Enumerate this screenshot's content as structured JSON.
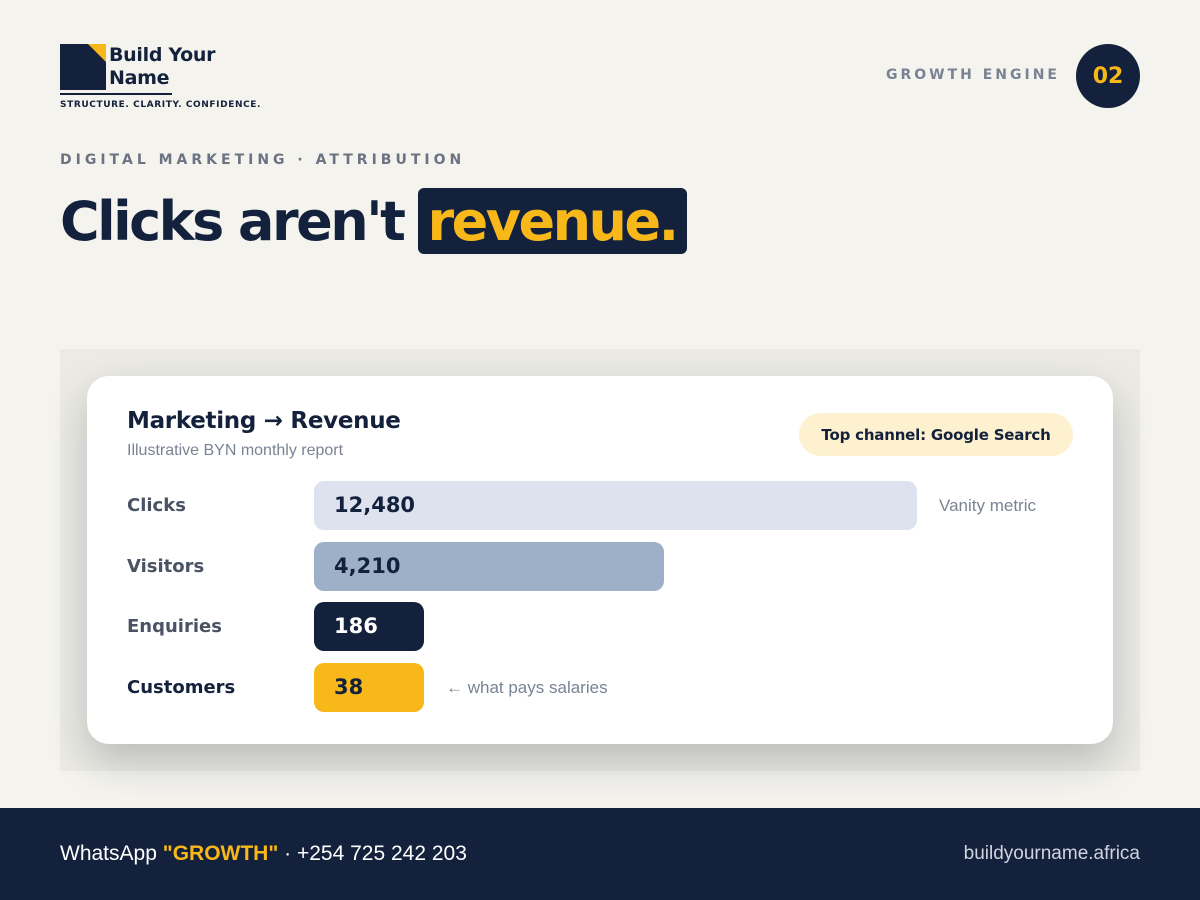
{
  "brand": {
    "name_line1": "Build Your",
    "name_line2": "Name",
    "tagline": "STRUCTURE. CLARITY. CONFIDENCE.",
    "colors": {
      "navy": "#13213c",
      "accent": "#f8b81a",
      "background": "#f4f3ee"
    }
  },
  "header": {
    "section_label": "GROWTH ENGINE",
    "section_number": "02"
  },
  "eyebrow": "DIGITAL MARKETING · ATTRIBUTION",
  "headline": {
    "text": "Clicks aren't",
    "highlight": "revenue."
  },
  "card": {
    "title": "Marketing → Revenue",
    "subtitle": "Illustrative BYN monthly report",
    "pill": "Top channel: Google Search"
  },
  "chart_data": {
    "type": "bar",
    "orientation": "horizontal",
    "title": "Marketing → Revenue",
    "subtitle": "Illustrative BYN monthly report",
    "categories": [
      "Clicks",
      "Visitors",
      "Enquiries",
      "Customers"
    ],
    "values": [
      12480,
      4210,
      186,
      38
    ],
    "value_labels": [
      "12,480",
      "4,210",
      "186",
      "38"
    ],
    "bar_colors": [
      "#dde2ee",
      "#9eb0c8",
      "#13213c",
      "#f8b81a"
    ],
    "annotations": [
      {
        "category": "Clicks",
        "text": "Vanity metric"
      },
      {
        "category": "Customers",
        "text": "← what pays salaries"
      }
    ]
  },
  "footer": {
    "whatsapp_prefix": "WhatsApp",
    "whatsapp_keyword": "\"GROWTH\"",
    "whatsapp_phone": "· +254 725 242 203",
    "website": "buildyourname.africa"
  }
}
